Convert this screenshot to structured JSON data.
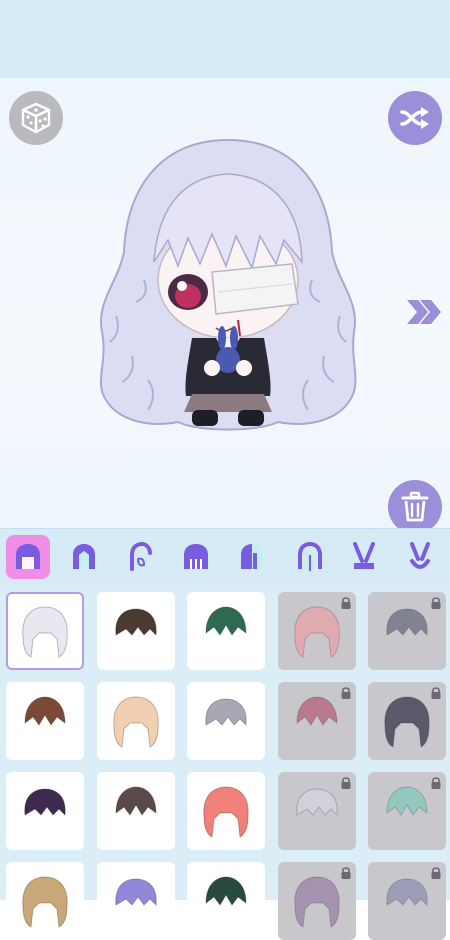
{
  "theme": {
    "accent": "#9a8fd8",
    "tab_active": "#ee8ee8",
    "header_bg": "#d6ebf6",
    "grid_bg": "#dbeef8"
  },
  "toolbar": {
    "random_icon": "dice-icon",
    "shuffle_icon": "shuffle-icon",
    "next_icon": "double-chevron-right-icon",
    "delete_icon": "trash-icon"
  },
  "tabs": [
    {
      "name": "hair-full",
      "active": true
    },
    {
      "name": "hair-front",
      "active": false
    },
    {
      "name": "hair-side",
      "active": false
    },
    {
      "name": "hair-bangs",
      "active": false
    },
    {
      "name": "hair-back",
      "active": false
    },
    {
      "name": "hair-tail",
      "active": false
    },
    {
      "name": "bunny-ears",
      "active": false
    },
    {
      "name": "ears-alt",
      "active": false
    }
  ],
  "items": [
    {
      "color": "#e8e8f0",
      "locked": false,
      "selected": true
    },
    {
      "color": "#4a3a32",
      "locked": false,
      "selected": false
    },
    {
      "color": "#2e6a52",
      "locked": false,
      "selected": false
    },
    {
      "color": "#e8a0a8",
      "locked": true,
      "selected": false
    },
    {
      "color": "#6a6c80",
      "locked": true,
      "selected": false
    },
    {
      "color": "#7a4a36",
      "locked": false,
      "selected": false
    },
    {
      "color": "#f2cfb0",
      "locked": false,
      "selected": false
    },
    {
      "color": "#a8a8b4",
      "locked": false,
      "selected": false
    },
    {
      "color": "#b4607a",
      "locked": true,
      "selected": false
    },
    {
      "color": "#34344a",
      "locked": true,
      "selected": false
    },
    {
      "color": "#3e2a4e",
      "locked": false,
      "selected": false
    },
    {
      "color": "#5a4a48",
      "locked": false,
      "selected": false
    },
    {
      "color": "#f08078",
      "locked": false,
      "selected": false
    },
    {
      "color": "#d4d4e0",
      "locked": true,
      "selected": false
    },
    {
      "color": "#80c8b8",
      "locked": true,
      "selected": false
    },
    {
      "color": "#c8a878",
      "locked": false,
      "selected": false
    },
    {
      "color": "#9088d8",
      "locked": false,
      "selected": false
    },
    {
      "color": "#2a4a40",
      "locked": false,
      "selected": false
    },
    {
      "color": "#9a80a8",
      "locked": true,
      "selected": false
    },
    {
      "color": "#8e90b0",
      "locked": true,
      "selected": false
    }
  ]
}
